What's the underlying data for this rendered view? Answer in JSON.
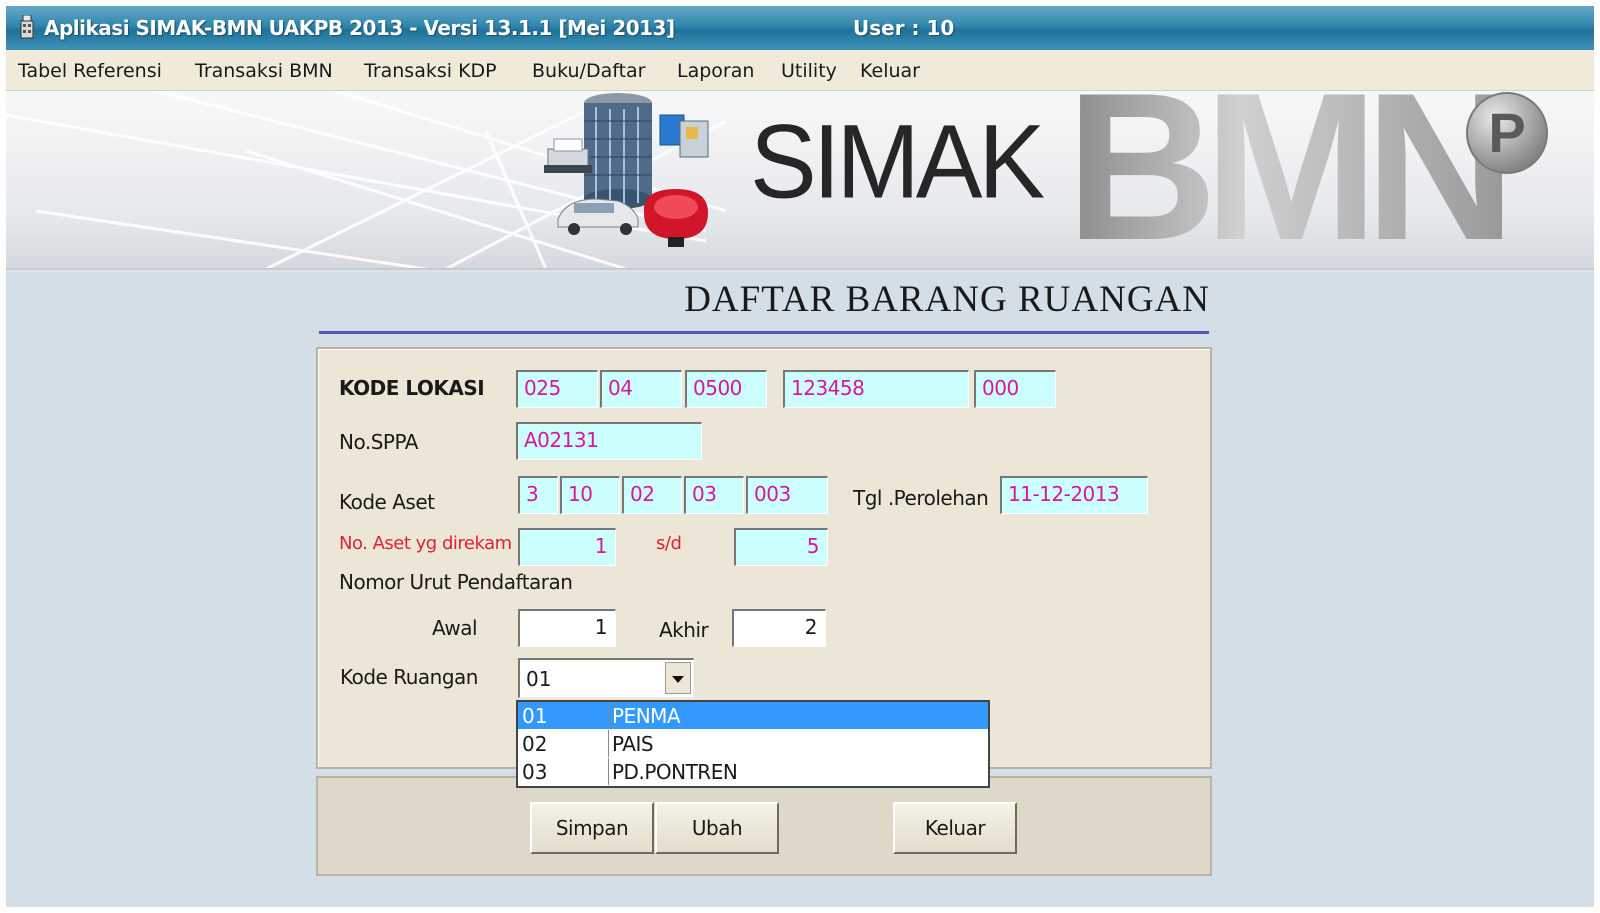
{
  "window": {
    "title": "Aplikasi SIMAK-BMN UAKPB 2013 - Versi 13.1.1 [Mei 2013]",
    "user": "User : 10"
  },
  "menu": [
    {
      "label": "Tabel Referensi"
    },
    {
      "label": "Transaksi BMN"
    },
    {
      "label": "Transaksi KDP"
    },
    {
      "label": "Buku/Daftar"
    },
    {
      "label": "Laporan"
    },
    {
      "label": "Utility"
    },
    {
      "label": "Keluar"
    }
  ],
  "banner": {
    "logo_simak": "SIMAK",
    "logo_bmn": "BMN",
    "logo_badge": "P"
  },
  "page": {
    "title": "DAFTAR BARANG RUANGAN"
  },
  "form": {
    "kode_lokasi": {
      "label": "KODE LOKASI",
      "values": [
        "025",
        "04",
        "0500",
        "123458",
        "000"
      ]
    },
    "no_sppa": {
      "label": "No.SPPA",
      "value": "A02131"
    },
    "kode_aset": {
      "label": "Kode Aset",
      "values": [
        "3",
        "10",
        "02",
        "03",
        "003"
      ]
    },
    "tgl_perolehan": {
      "label": "Tgl .Perolehan",
      "value": "11-12-2013"
    },
    "no_aset": {
      "label": "No. Aset yg direkam",
      "from": "1",
      "sd_label": "s/d",
      "to": "5"
    },
    "nomor_urut": {
      "label": "Nomor Urut Pendaftaran",
      "awal_label": "Awal",
      "awal": "1",
      "akhir_label": "Akhir",
      "akhir": "2"
    },
    "kode_ruangan": {
      "label": "Kode Ruangan",
      "value": "01",
      "options": [
        {
          "code": "01",
          "name": "PENMA",
          "selected": true
        },
        {
          "code": "02",
          "name": "PAIS",
          "selected": false
        },
        {
          "code": "03",
          "name": "PD.PONTREN",
          "selected": false
        }
      ]
    }
  },
  "buttons": {
    "simpan": "Simpan",
    "ubah": "Ubah",
    "keluar": "Keluar"
  },
  "colors": {
    "field_bg": "#ccffff",
    "field_text": "#d6189a",
    "panel_bg": "#ece6d6",
    "window_bg": "#d3dee6",
    "accent_rule": "#5558b5",
    "selection": "#3399ff",
    "red_label": "#e0203a"
  }
}
